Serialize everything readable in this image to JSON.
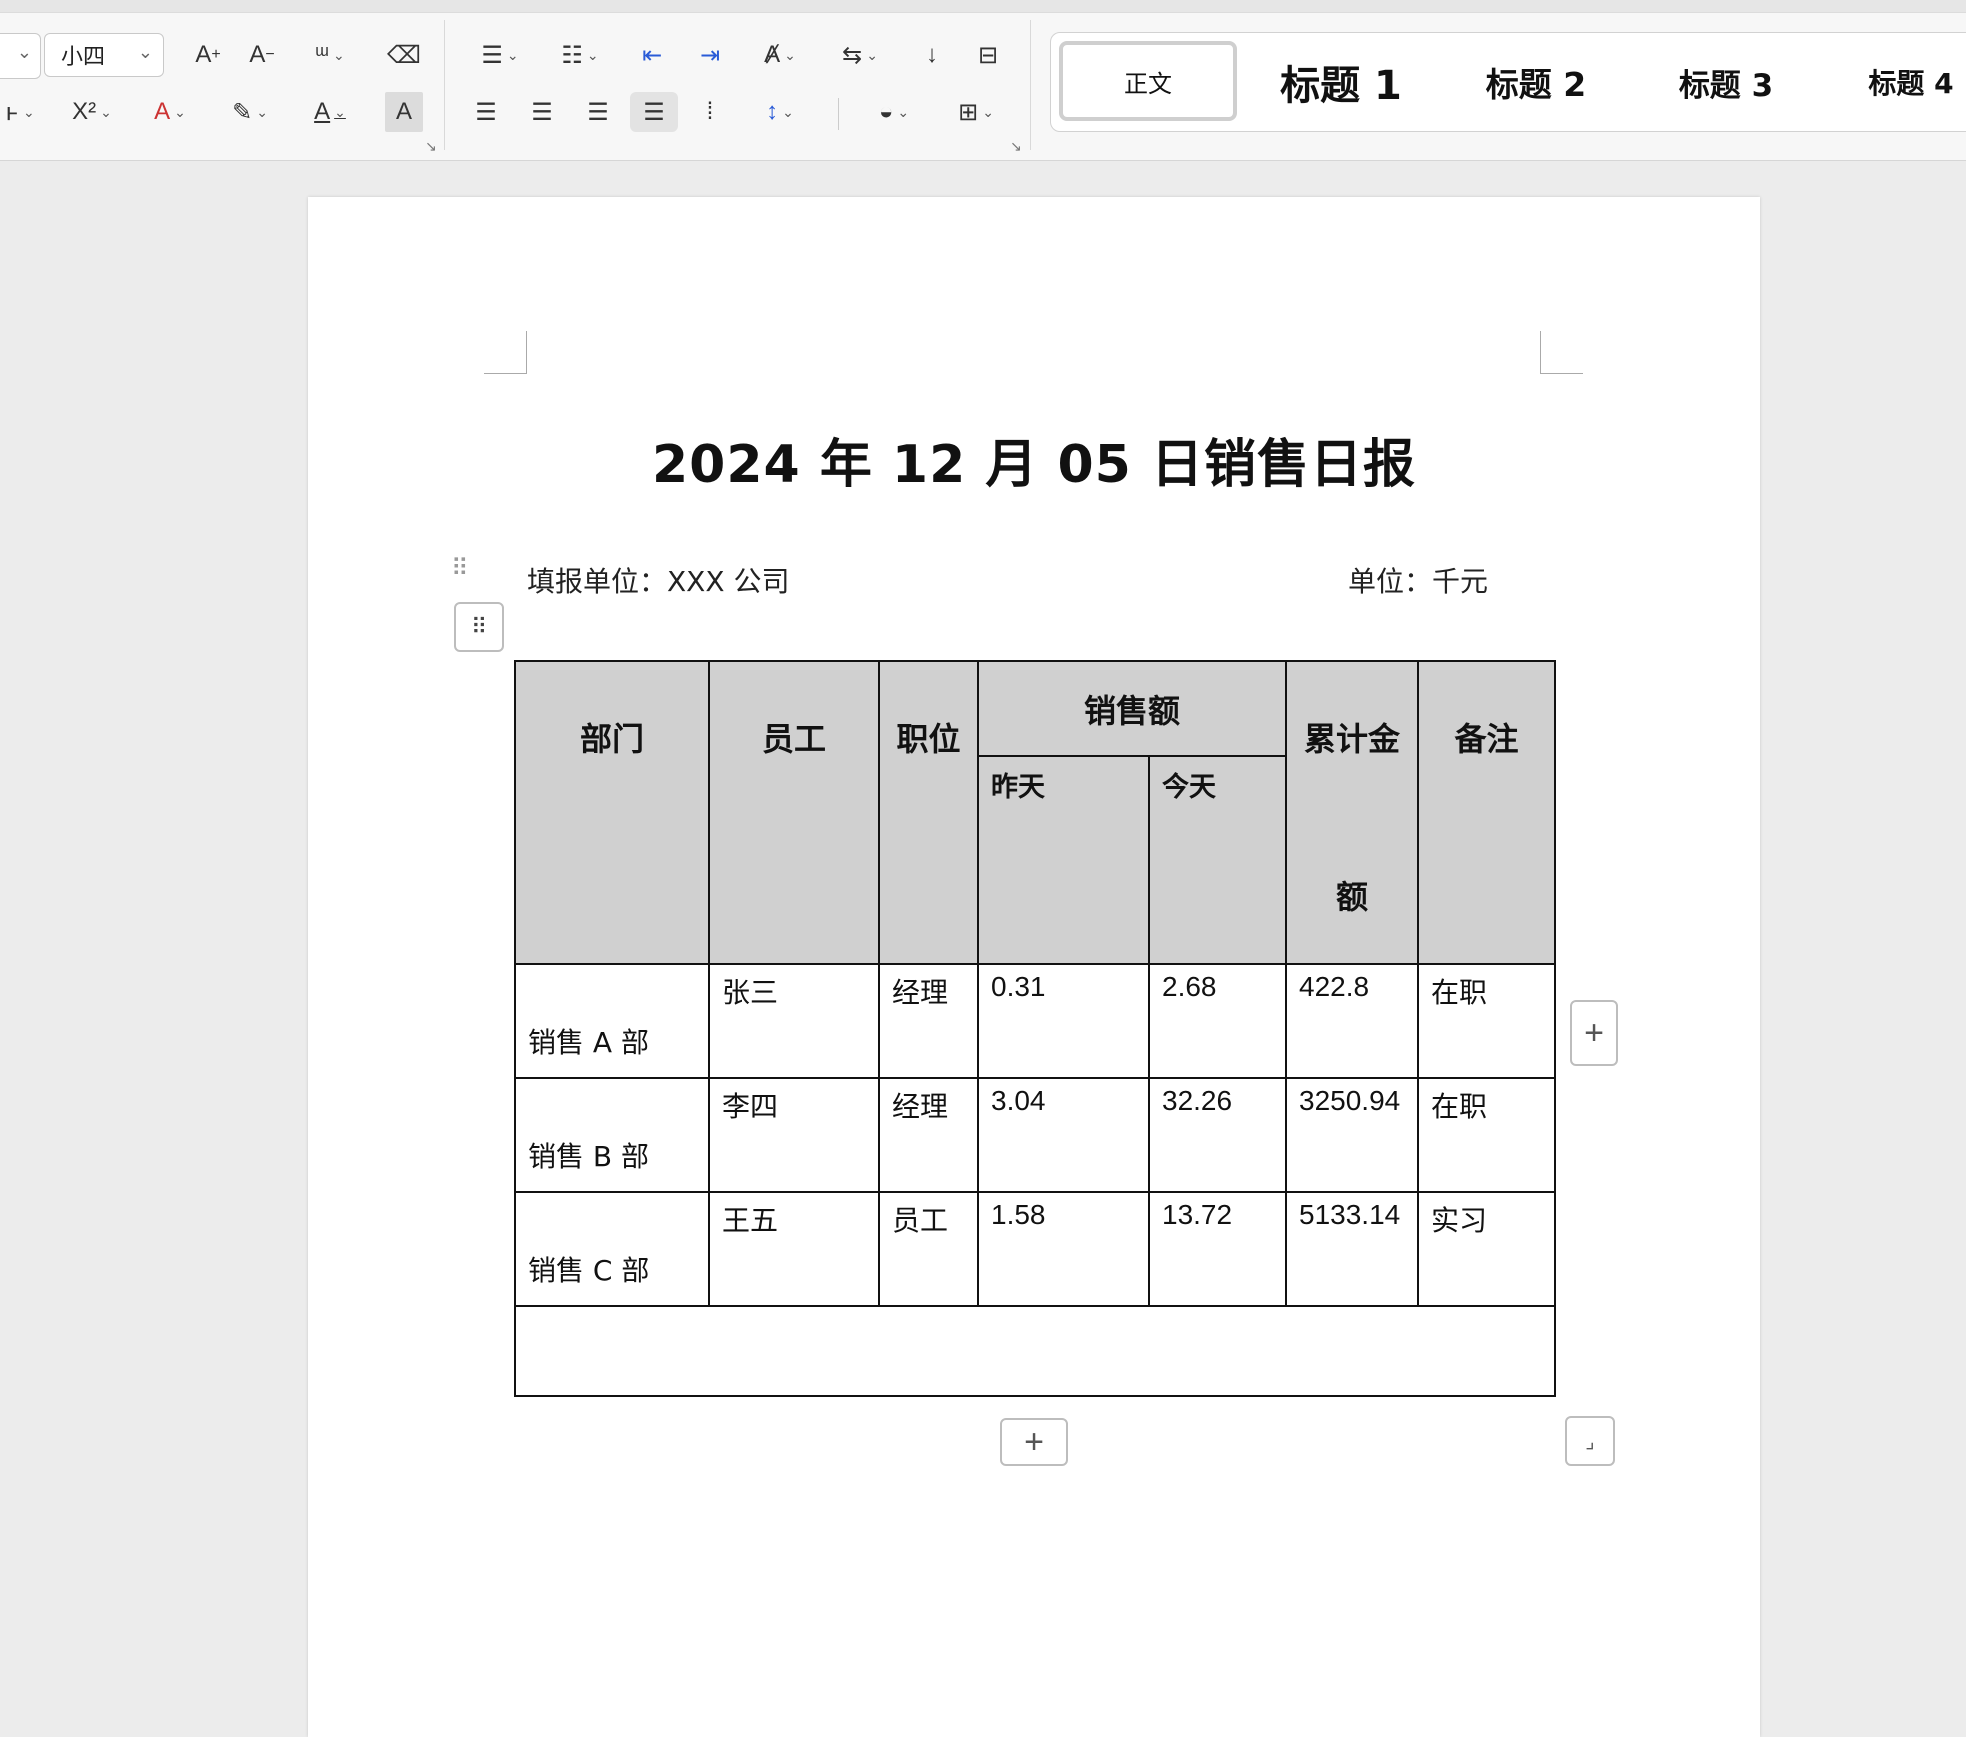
{
  "ribbon": {
    "font_size_value": "小四",
    "row1_tools": [
      {
        "name": "grow-font-icon",
        "glyph": "A⁺"
      },
      {
        "name": "shrink-font-icon",
        "glyph": "A⁻"
      },
      {
        "name": "phonetic-guide-icon",
        "glyph": "ᵚ"
      },
      {
        "name": "clear-format-icon",
        "glyph": "⌫"
      }
    ],
    "row2_tools": [
      {
        "name": "superscript-icon",
        "glyph": "X²"
      },
      {
        "name": "text-effect-icon",
        "glyph": "A"
      },
      {
        "name": "highlight-icon",
        "glyph": "✎"
      },
      {
        "name": "font-color-icon",
        "glyph": "A"
      },
      {
        "name": "char-shading-icon",
        "glyph": "A"
      }
    ],
    "styles": {
      "normal": "正文",
      "h1": "标题 1",
      "h2": "标题 2",
      "h3": "标题 3",
      "h4": "标题 4"
    }
  },
  "document": {
    "title": "2024 年 12 月 05 日销售日报",
    "reporting_unit": "填报单位：XXX 公司",
    "unit": "单位：千元"
  },
  "table": {
    "headers": {
      "dept": "部门",
      "employee": "员工",
      "position": "职位",
      "sales": "销售额",
      "yesterday": "昨天",
      "today": "今天",
      "cumulative_line1": "累计金",
      "cumulative_line2": "额",
      "remark": "备注"
    },
    "rows": [
      {
        "dept": "销售 A 部",
        "employee": "张三",
        "position": "经理",
        "yesterday": "0.31",
        "today": "2.68",
        "cumulative": "422.8",
        "remark": "在职"
      },
      {
        "dept": "销售 B 部",
        "employee": "李四",
        "position": "经理",
        "yesterday": "3.04",
        "today": "32.26",
        "cumulative": "3250.94",
        "remark": "在职"
      },
      {
        "dept": "销售 C 部",
        "employee": "王五",
        "position": "员工",
        "yesterday": "1.58",
        "today": "13.72",
        "cumulative": "5133.14",
        "remark": "实习"
      }
    ]
  }
}
